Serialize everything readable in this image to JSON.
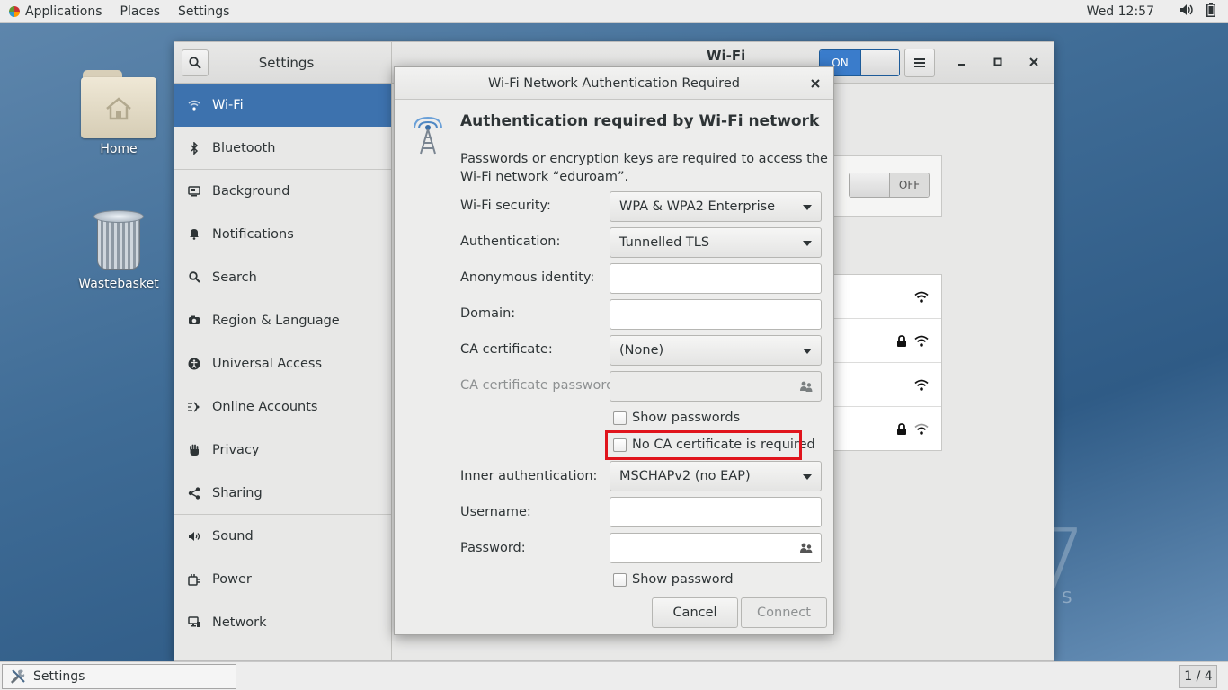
{
  "topbar": {
    "applications": "Applications",
    "places": "Places",
    "settings": "Settings",
    "clock": "Wed 12:57"
  },
  "desktop": {
    "home_label": "Home",
    "trash_label": "Wastebasket",
    "watermark_text": "TOS",
    "watermark_digit": "7"
  },
  "settings_window": {
    "title": "Settings",
    "panel_title": "Wi-Fi",
    "wifi_switch": "ON",
    "airplane_switch": "OFF",
    "sidebar": [
      {
        "label": "Wi-Fi",
        "icon": "wifi-icon"
      },
      {
        "label": "Bluetooth",
        "icon": "bluetooth-icon"
      },
      {
        "label": "Background",
        "icon": "background-icon"
      },
      {
        "label": "Notifications",
        "icon": "bell-icon"
      },
      {
        "label": "Search",
        "icon": "search-icon"
      },
      {
        "label": "Region & Language",
        "icon": "camera-icon"
      },
      {
        "label": "Universal Access",
        "icon": "accessibility-icon"
      },
      {
        "label": "Online Accounts",
        "icon": "online-accounts-icon"
      },
      {
        "label": "Privacy",
        "icon": "hand-icon"
      },
      {
        "label": "Sharing",
        "icon": "share-icon"
      },
      {
        "label": "Sound",
        "icon": "speaker-icon"
      },
      {
        "label": "Power",
        "icon": "power-icon"
      },
      {
        "label": "Network",
        "icon": "network-icon"
      }
    ]
  },
  "dialog": {
    "title": "Wi-Fi Network Authentication Required",
    "heading": "Authentication required by Wi-Fi network",
    "description": "Passwords or encryption keys are required to access the Wi-Fi network “eduroam”.",
    "wifi_security_label": "Wi-Fi security:",
    "wifi_security_value": "WPA & WPA2 Enterprise",
    "authentication_label": "Authentication:",
    "authentication_value": "Tunnelled TLS",
    "anonymous_identity_label": "Anonymous identity:",
    "anonymous_identity_value": "",
    "domain_label": "Domain:",
    "domain_value": "",
    "ca_certificate_label": "CA certificate:",
    "ca_certificate_value": "(None)",
    "ca_password_label": "CA certificate password:",
    "ca_password_value": "",
    "show_passwords_label": "Show passwords",
    "no_ca_label": "No CA certificate is required",
    "inner_auth_label": "Inner authentication:",
    "inner_auth_value": "MSCHAPv2 (no EAP)",
    "username_label": "Username:",
    "username_value": "",
    "password_label": "Password:",
    "password_value": "",
    "show_password_label": "Show password",
    "cancel_label": "Cancel",
    "connect_label": "Connect"
  },
  "taskbar": {
    "task_label": "Settings",
    "workspace": "1 / 4"
  },
  "colors": {
    "accent": "#3d72ae",
    "highlight": "#e0141c"
  }
}
